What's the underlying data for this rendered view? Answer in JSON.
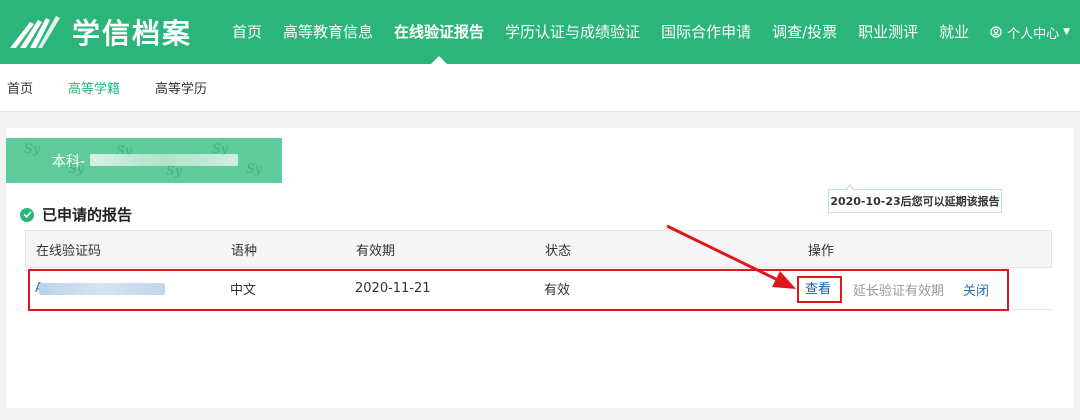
{
  "app": {
    "logo_text": "学信档案"
  },
  "nav": {
    "items": [
      {
        "label": "首页"
      },
      {
        "label": "高等教育信息"
      },
      {
        "label": "在线验证报告",
        "active": true
      },
      {
        "label": "学历认证与成绩验证"
      },
      {
        "label": "国际合作申请"
      },
      {
        "label": "调查/投票"
      },
      {
        "label": "职业测评"
      },
      {
        "label": "就业"
      }
    ],
    "user_center": "个人中心"
  },
  "subnav": {
    "items": [
      {
        "label": "首页"
      },
      {
        "label": "高等学籍",
        "active": true
      },
      {
        "label": "高等学历"
      }
    ]
  },
  "banner": {
    "label": "本科-"
  },
  "section": {
    "title": "已申请的报告"
  },
  "table": {
    "headers": [
      "在线验证码",
      "语种",
      "有效期",
      "状态",
      "操作"
    ],
    "rows": [
      {
        "code_prefix": "A",
        "language": "中文",
        "expiry": "2020-11-21",
        "status": "有效",
        "actions": {
          "view": "查看",
          "extend": "延长验证有效期",
          "close": "关闭"
        }
      }
    ]
  },
  "tooltip": {
    "text": "2020-10-23后您可以延期该报告"
  },
  "colors": {
    "brand": "#2bb57b",
    "annotation": "#e0161d",
    "link": "#2b6fb3"
  }
}
